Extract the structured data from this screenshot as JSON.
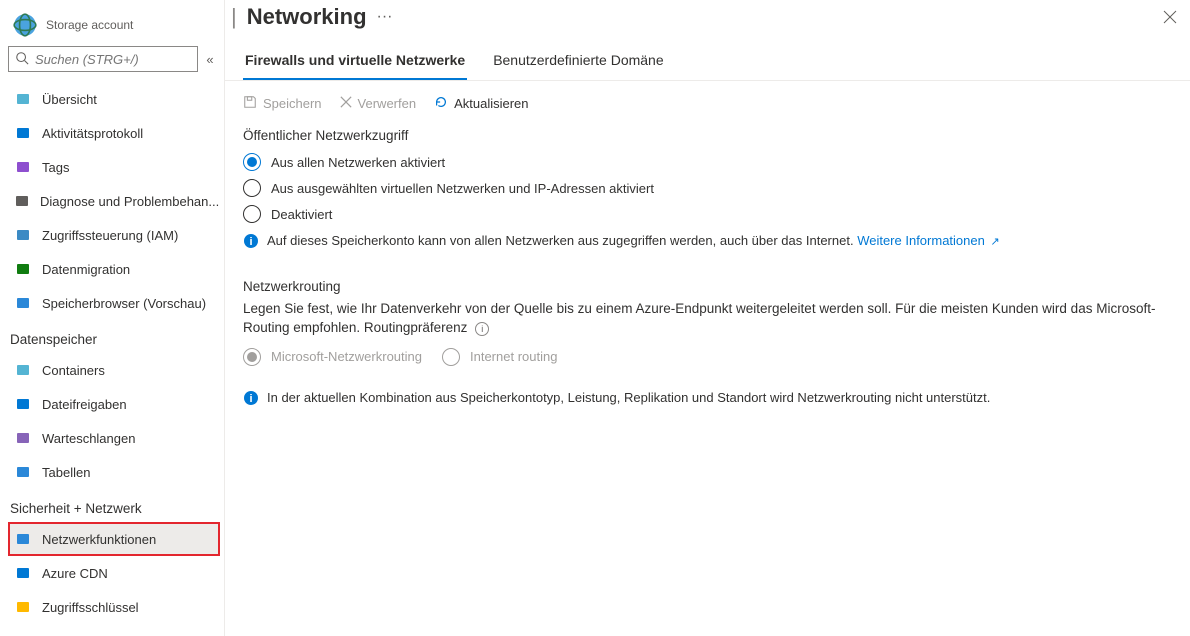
{
  "sidebar": {
    "subtitle": "Storage account",
    "search_placeholder": "Suchen (STRG+/)",
    "collapse_glyph": "«",
    "groups": [
      {
        "name": "",
        "items": [
          {
            "id": "overview",
            "label": "Übersicht",
            "icon_color": "#54B4D3"
          },
          {
            "id": "activity",
            "label": "Aktivitätsprotokoll",
            "icon_color": "#0078D4"
          },
          {
            "id": "tags",
            "label": "Tags",
            "icon_color": "#8E4FCF"
          },
          {
            "id": "diagnose",
            "label": "Diagnose und Problembehan...",
            "icon_color": "#605E5C"
          },
          {
            "id": "iam",
            "label": "Zugriffssteuerung (IAM)",
            "icon_color": "#3B8AC4"
          },
          {
            "id": "migration",
            "label": "Datenmigration",
            "icon_color": "#107C10"
          },
          {
            "id": "browser",
            "label": "Speicherbrowser (Vorschau)",
            "icon_color": "#2B88D8"
          }
        ]
      },
      {
        "name": "Datenspeicher",
        "items": [
          {
            "id": "containers",
            "label": "Containers",
            "icon_color": "#54B4D3"
          },
          {
            "id": "fileshares",
            "label": "Dateifreigaben",
            "icon_color": "#0078D4"
          },
          {
            "id": "queues",
            "label": "Warteschlangen",
            "icon_color": "#8764B8"
          },
          {
            "id": "tables",
            "label": "Tabellen",
            "icon_color": "#2B88D8"
          }
        ]
      },
      {
        "name": "Sicherheit + Netzwerk",
        "items": [
          {
            "id": "networking",
            "label": "Netzwerkfunktionen",
            "icon_color": "#2B88D8",
            "selected": true,
            "highlighted": true
          },
          {
            "id": "cdn",
            "label": "Azure CDN",
            "icon_color": "#0078D4"
          },
          {
            "id": "keys",
            "label": "Zugriffsschlüssel",
            "icon_color": "#FFB900"
          }
        ]
      }
    ]
  },
  "header": {
    "separator": "|",
    "title": "Networking",
    "ellipsis": "···"
  },
  "tabs": [
    {
      "id": "firewalls",
      "label": "Firewalls und virtuelle Netzwerke",
      "active": true
    },
    {
      "id": "domain",
      "label": "Benutzerdefinierte Domäne",
      "active": false
    }
  ],
  "toolbar": {
    "save": {
      "label": "Speichern",
      "enabled": false
    },
    "discard": {
      "label": "Verwerfen",
      "enabled": false
    },
    "refresh": {
      "label": "Aktualisieren",
      "enabled": true
    }
  },
  "access": {
    "heading": "Öffentlicher Netzwerkzugriff",
    "options": [
      {
        "id": "all",
        "label": "Aus allen Netzwerken aktiviert",
        "checked": true
      },
      {
        "id": "select",
        "label": "Aus ausgewählten virtuellen Netzwerken und IP-Adressen aktiviert",
        "checked": false
      },
      {
        "id": "disabled",
        "label": "Deaktiviert",
        "checked": false
      }
    ],
    "info_text": "Auf dieses Speicherkonto kann von allen Netzwerken aus zugegriffen werden, auch über das Internet. ",
    "info_link": "Weitere Informationen"
  },
  "routing": {
    "heading": "Netzwerkrouting",
    "desc": "Legen Sie fest, wie Ihr Datenverkehr von der Quelle bis zu einem Azure-Endpunkt weitergeleitet werden soll. Für die meisten Kunden wird das Microsoft-Routing empfohlen.",
    "pref_label": "Routingpräferenz",
    "options": [
      {
        "id": "ms",
        "label": "Microsoft-Netzwerkrouting",
        "checked": true,
        "disabled": true
      },
      {
        "id": "net",
        "label": "Internet routing",
        "checked": false,
        "disabled": true
      }
    ],
    "warn_text": "In der aktuellen Kombination aus Speicherkontotyp, Leistung, Replikation und Standort wird Netzwerkrouting nicht unterstützt."
  }
}
